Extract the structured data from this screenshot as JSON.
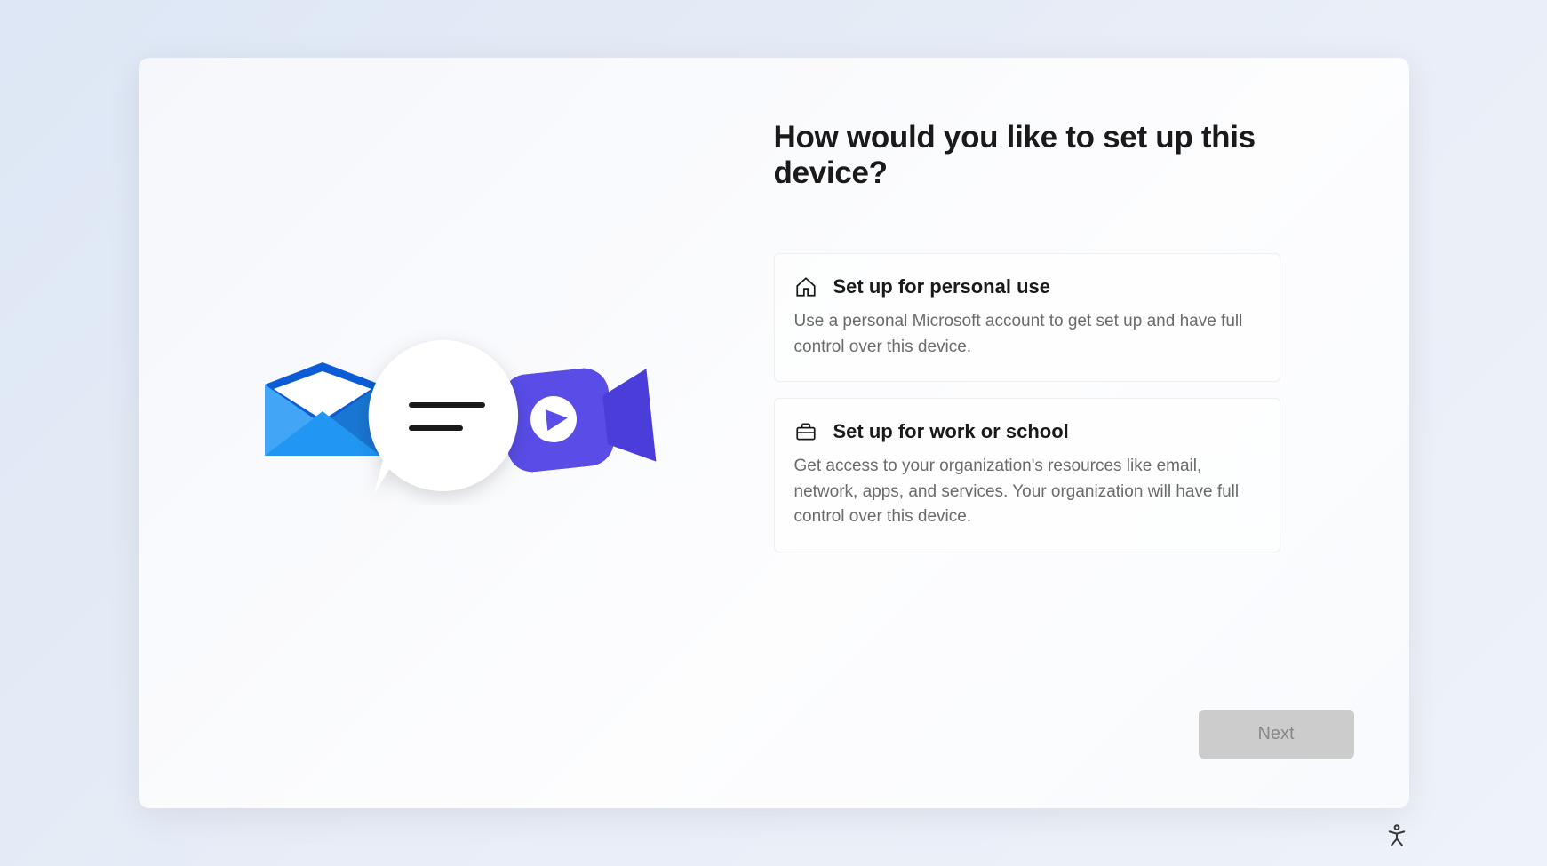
{
  "title": "How would you like to set up this device?",
  "options": {
    "personal": {
      "title": "Set up for personal use",
      "description": "Use a personal Microsoft account to get set up and have full control over this device."
    },
    "work": {
      "title": "Set up for work or school",
      "description": "Get access to your organization's resources like email, network, apps, and services. Your organization will have full control over this device."
    }
  },
  "buttons": {
    "next": "Next"
  }
}
